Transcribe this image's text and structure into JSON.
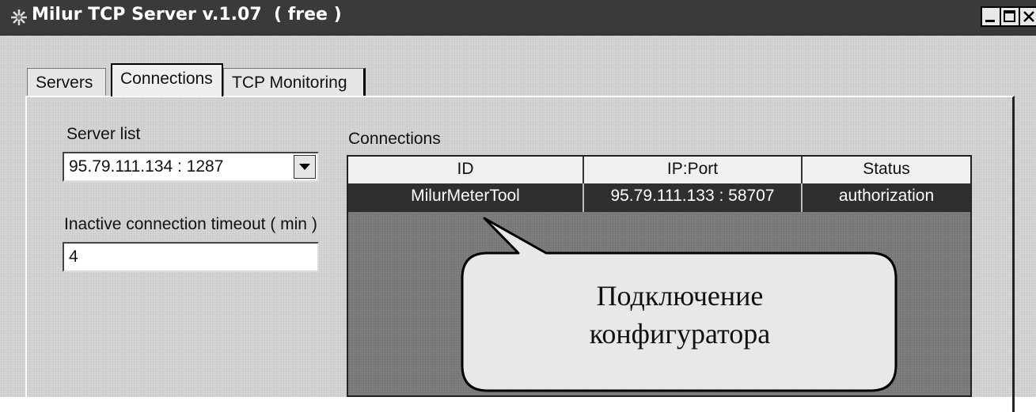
{
  "window": {
    "title": "Milur TCP Server v.1.07  ( free )",
    "icon": "app-icon",
    "controls": [
      "minimize-icon",
      "maximize-icon",
      "close-icon"
    ]
  },
  "tabs": [
    {
      "label": "Servers",
      "active": false
    },
    {
      "label": "Connections",
      "active": true
    },
    {
      "label": "TCP Monitoring",
      "active": false
    }
  ],
  "left": {
    "server_list_label": "Server list",
    "server_list_value": "95.79.111.134 : 1287",
    "timeout_label": "Inactive connection timeout ( min )",
    "timeout_value": "4"
  },
  "connections": {
    "label": "Connections",
    "columns": [
      "ID",
      "IP:Port",
      "Status"
    ],
    "rows": [
      {
        "id": "MilurMeterTool",
        "ip_port": "95.79.111.133 : 58707",
        "status": "authorization",
        "selected": true
      }
    ]
  },
  "callout": {
    "line1": "Подключение",
    "line2": "конфигуратора"
  },
  "colors": {
    "titlebar": "#3a3a3a",
    "selected_row": "#2f2f2f",
    "grid_bg": "#7f7f7f"
  }
}
